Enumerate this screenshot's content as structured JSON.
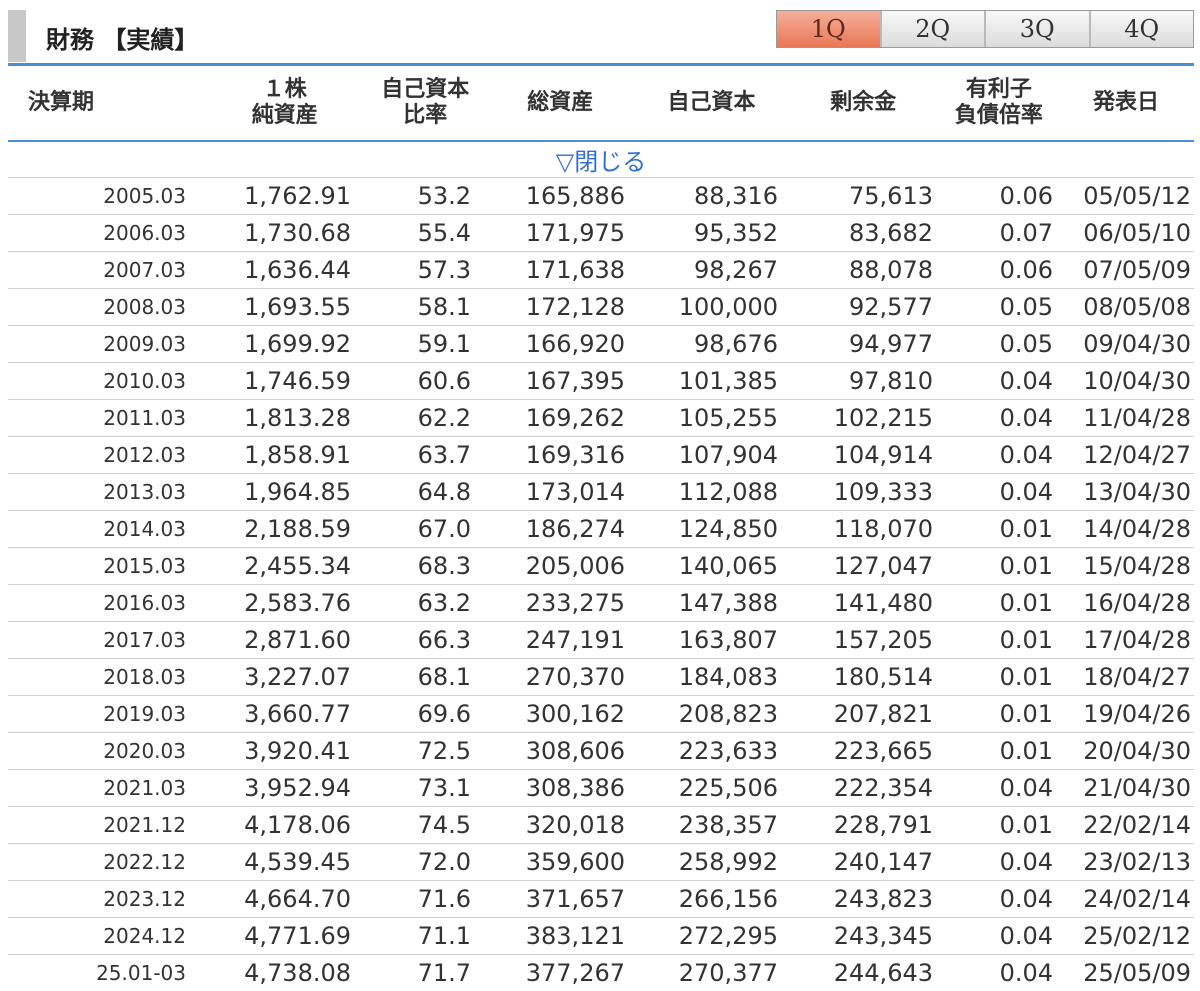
{
  "section": {
    "title": "財務 【実績】"
  },
  "tabs": [
    {
      "label": "1Q",
      "active": true
    },
    {
      "label": "2Q",
      "active": false
    },
    {
      "label": "3Q",
      "active": false
    },
    {
      "label": "4Q",
      "active": false
    }
  ],
  "columns": {
    "period": "決算期",
    "bps": "１株\n純資産",
    "equity_ratio": "自己資本\n比率",
    "total_assets": "総資産",
    "equity": "自己資本",
    "retained_earnings": "剰余金",
    "de_ratio": "有利子\n負債倍率",
    "announce_date": "発表日"
  },
  "toggle_label": "▽閉じる",
  "rows": [
    {
      "period": "2005.03",
      "bps": "1,762.91",
      "equity_ratio": "53.2",
      "total_assets": "165,886",
      "equity": "88,316",
      "retained_earnings": "75,613",
      "de_ratio": "0.06",
      "announce_date": "05/05/12"
    },
    {
      "period": "2006.03",
      "bps": "1,730.68",
      "equity_ratio": "55.4",
      "total_assets": "171,975",
      "equity": "95,352",
      "retained_earnings": "83,682",
      "de_ratio": "0.07",
      "announce_date": "06/05/10"
    },
    {
      "period": "2007.03",
      "bps": "1,636.44",
      "equity_ratio": "57.3",
      "total_assets": "171,638",
      "equity": "98,267",
      "retained_earnings": "88,078",
      "de_ratio": "0.06",
      "announce_date": "07/05/09"
    },
    {
      "period": "2008.03",
      "bps": "1,693.55",
      "equity_ratio": "58.1",
      "total_assets": "172,128",
      "equity": "100,000",
      "retained_earnings": "92,577",
      "de_ratio": "0.05",
      "announce_date": "08/05/08"
    },
    {
      "period": "2009.03",
      "bps": "1,699.92",
      "equity_ratio": "59.1",
      "total_assets": "166,920",
      "equity": "98,676",
      "retained_earnings": "94,977",
      "de_ratio": "0.05",
      "announce_date": "09/04/30"
    },
    {
      "period": "2010.03",
      "bps": "1,746.59",
      "equity_ratio": "60.6",
      "total_assets": "167,395",
      "equity": "101,385",
      "retained_earnings": "97,810",
      "de_ratio": "0.04",
      "announce_date": "10/04/30"
    },
    {
      "period": "2011.03",
      "bps": "1,813.28",
      "equity_ratio": "62.2",
      "total_assets": "169,262",
      "equity": "105,255",
      "retained_earnings": "102,215",
      "de_ratio": "0.04",
      "announce_date": "11/04/28"
    },
    {
      "period": "2012.03",
      "bps": "1,858.91",
      "equity_ratio": "63.7",
      "total_assets": "169,316",
      "equity": "107,904",
      "retained_earnings": "104,914",
      "de_ratio": "0.04",
      "announce_date": "12/04/27"
    },
    {
      "period": "2013.03",
      "bps": "1,964.85",
      "equity_ratio": "64.8",
      "total_assets": "173,014",
      "equity": "112,088",
      "retained_earnings": "109,333",
      "de_ratio": "0.04",
      "announce_date": "13/04/30"
    },
    {
      "period": "2014.03",
      "bps": "2,188.59",
      "equity_ratio": "67.0",
      "total_assets": "186,274",
      "equity": "124,850",
      "retained_earnings": "118,070",
      "de_ratio": "0.01",
      "announce_date": "14/04/28"
    },
    {
      "period": "2015.03",
      "bps": "2,455.34",
      "equity_ratio": "68.3",
      "total_assets": "205,006",
      "equity": "140,065",
      "retained_earnings": "127,047",
      "de_ratio": "0.01",
      "announce_date": "15/04/28"
    },
    {
      "period": "2016.03",
      "bps": "2,583.76",
      "equity_ratio": "63.2",
      "total_assets": "233,275",
      "equity": "147,388",
      "retained_earnings": "141,480",
      "de_ratio": "0.01",
      "announce_date": "16/04/28"
    },
    {
      "period": "2017.03",
      "bps": "2,871.60",
      "equity_ratio": "66.3",
      "total_assets": "247,191",
      "equity": "163,807",
      "retained_earnings": "157,205",
      "de_ratio": "0.01",
      "announce_date": "17/04/28"
    },
    {
      "period": "2018.03",
      "bps": "3,227.07",
      "equity_ratio": "68.1",
      "total_assets": "270,370",
      "equity": "184,083",
      "retained_earnings": "180,514",
      "de_ratio": "0.01",
      "announce_date": "18/04/27"
    },
    {
      "period": "2019.03",
      "bps": "3,660.77",
      "equity_ratio": "69.6",
      "total_assets": "300,162",
      "equity": "208,823",
      "retained_earnings": "207,821",
      "de_ratio": "0.01",
      "announce_date": "19/04/26"
    },
    {
      "period": "2020.03",
      "bps": "3,920.41",
      "equity_ratio": "72.5",
      "total_assets": "308,606",
      "equity": "223,633",
      "retained_earnings": "223,665",
      "de_ratio": "0.01",
      "announce_date": "20/04/30"
    },
    {
      "period": "2021.03",
      "bps": "3,952.94",
      "equity_ratio": "73.1",
      "total_assets": "308,386",
      "equity": "225,506",
      "retained_earnings": "222,354",
      "de_ratio": "0.04",
      "announce_date": "21/04/30"
    },
    {
      "period": "2021.12",
      "bps": "4,178.06",
      "equity_ratio": "74.5",
      "total_assets": "320,018",
      "equity": "238,357",
      "retained_earnings": "228,791",
      "de_ratio": "0.01",
      "announce_date": "22/02/14"
    },
    {
      "period": "2022.12",
      "bps": "4,539.45",
      "equity_ratio": "72.0",
      "total_assets": "359,600",
      "equity": "258,992",
      "retained_earnings": "240,147",
      "de_ratio": "0.04",
      "announce_date": "23/02/13"
    },
    {
      "period": "2023.12",
      "bps": "4,664.70",
      "equity_ratio": "71.6",
      "total_assets": "371,657",
      "equity": "266,156",
      "retained_earnings": "243,823",
      "de_ratio": "0.04",
      "announce_date": "24/02/14"
    },
    {
      "period": "2024.12",
      "bps": "4,771.69",
      "equity_ratio": "71.1",
      "total_assets": "383,121",
      "equity": "272,295",
      "retained_earnings": "243,345",
      "de_ratio": "0.04",
      "announce_date": "25/02/12"
    },
    {
      "period": "25.01-03",
      "bps": "4,738.08",
      "equity_ratio": "71.7",
      "total_assets": "377,267",
      "equity": "270,377",
      "retained_earnings": "244,643",
      "de_ratio": "0.04",
      "announce_date": "25/05/09"
    }
  ]
}
